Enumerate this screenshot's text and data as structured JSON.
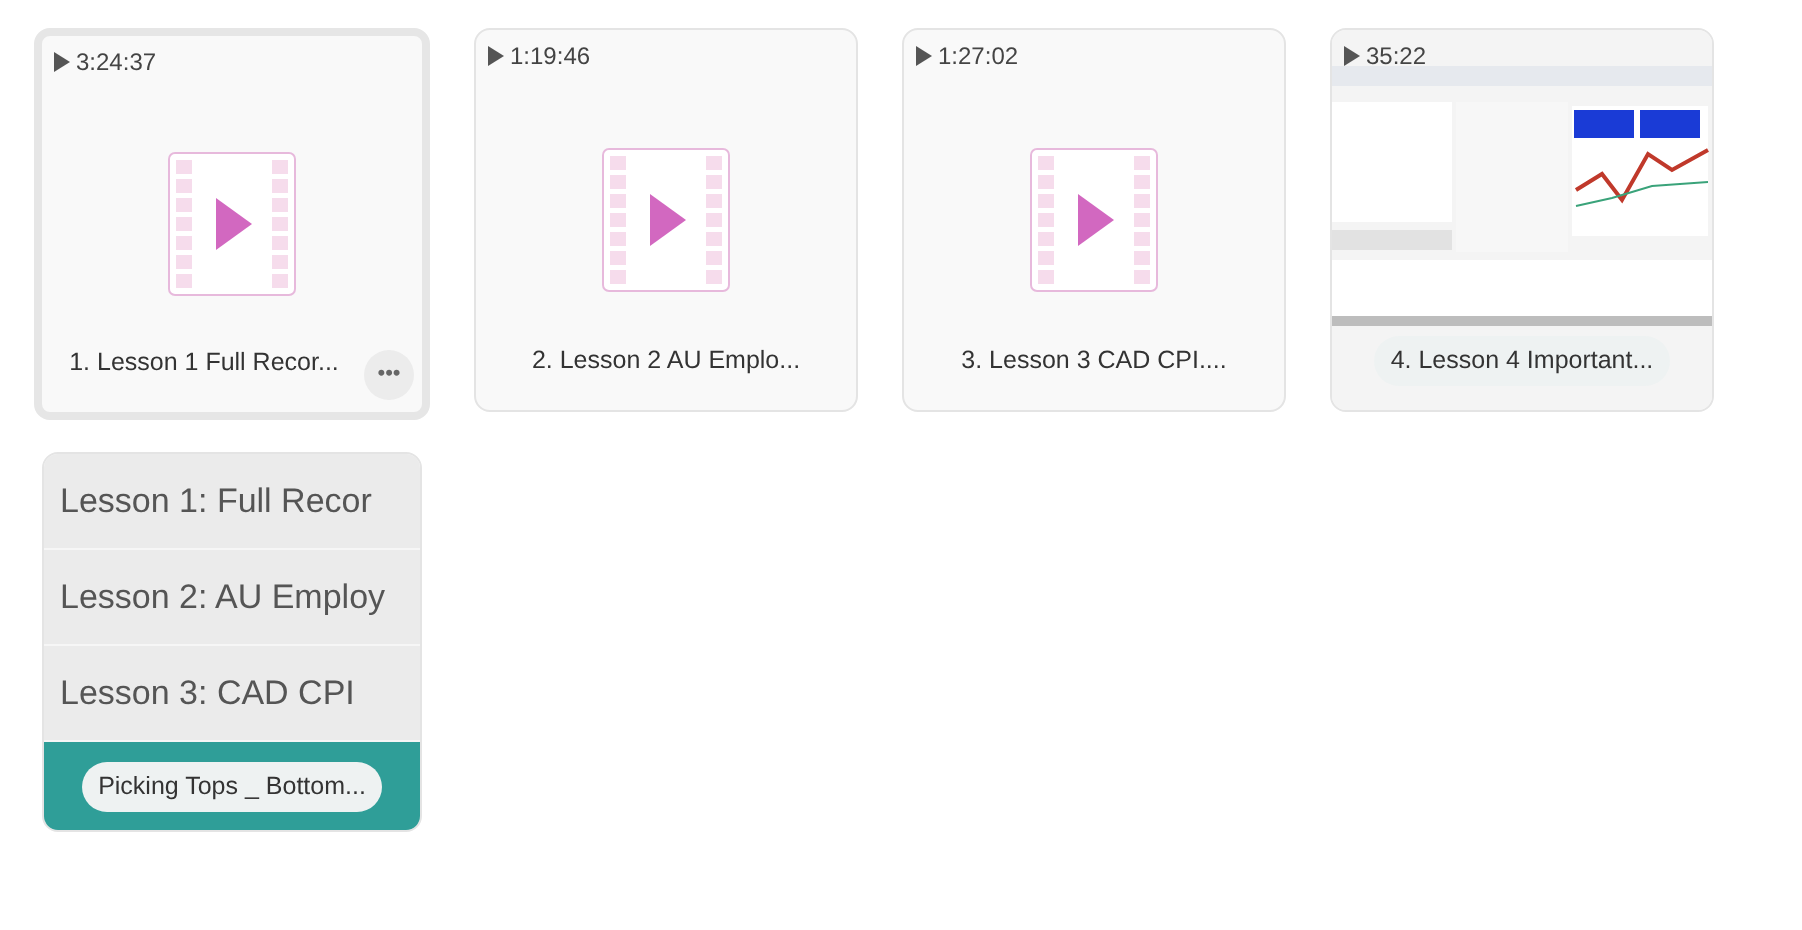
{
  "cards": [
    {
      "kind": "placeholder",
      "duration": "3:24:37",
      "title": "1. Lesson 1 Full Recor...",
      "selected": true,
      "more": "•••"
    },
    {
      "kind": "placeholder",
      "duration": "1:19:46",
      "title": "2. Lesson 2 AU Emplo...",
      "selected": false
    },
    {
      "kind": "placeholder",
      "duration": "1:27:02",
      "title": "3. Lesson 3 CAD CPI....",
      "selected": false
    },
    {
      "kind": "picture",
      "duration": "35:22",
      "title": "4. Lesson 4 Important...",
      "selected": false
    },
    {
      "kind": "list",
      "title": "Picking Tops _ Bottom...",
      "selected": false,
      "rows": [
        "Lesson 1: Full Recor",
        "Lesson 2: AU Employ",
        "Lesson 3: CAD CPI"
      ]
    }
  ]
}
